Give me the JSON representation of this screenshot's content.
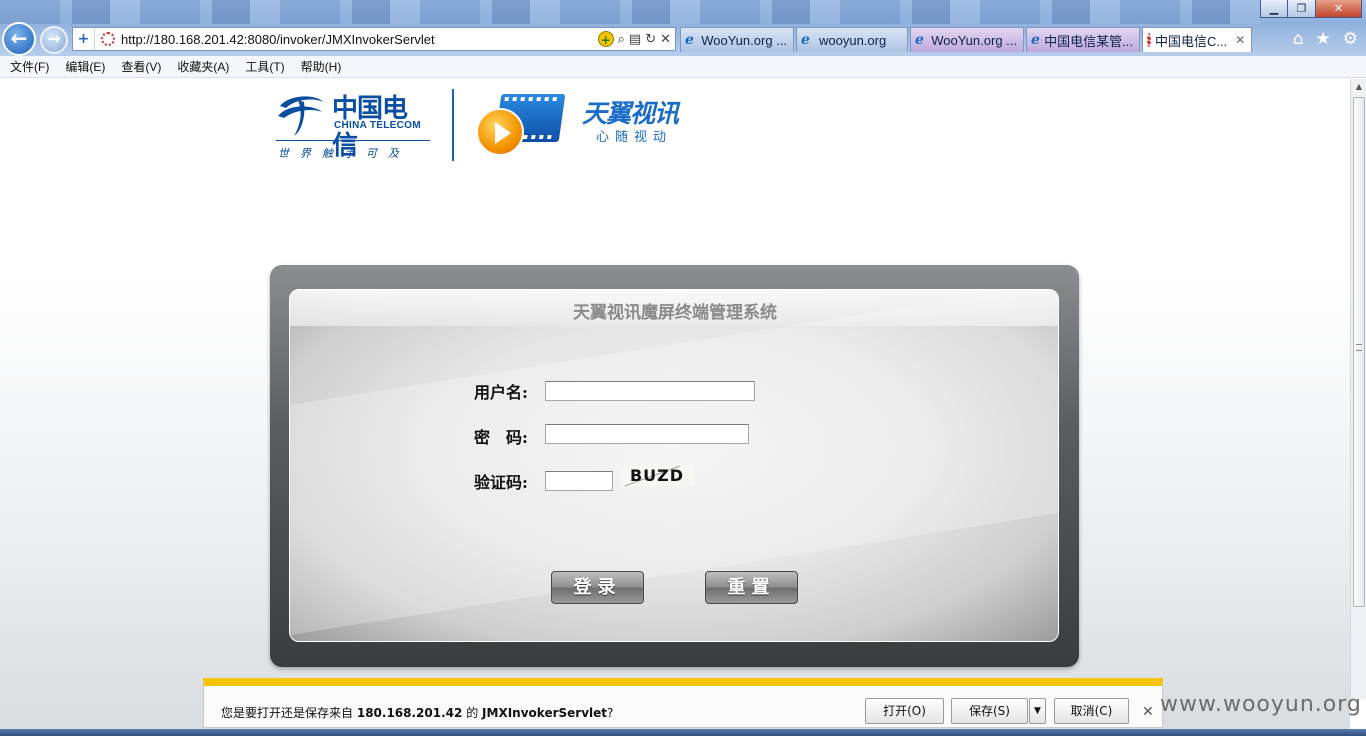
{
  "browser": {
    "window_buttons": [
      "▁",
      "❐",
      "✕"
    ],
    "address_url": "http://180.168.201.42:8080/invoker/JMXInvokerServlet",
    "tabs": [
      {
        "label": "WooYun.org ..."
      },
      {
        "label": "wooyun.org"
      },
      {
        "label": "WooYun.org ..."
      },
      {
        "label": "中国电信某管..."
      },
      {
        "label": "中国电信C..."
      }
    ],
    "menu": [
      "文件(F)",
      "编辑(E)",
      "查看(V)",
      "收藏夹(A)",
      "工具(T)",
      "帮助(H)"
    ]
  },
  "logos": {
    "telecom_cn": "中国电信",
    "telecom_en": "CHINA TELECOM",
    "telecom_slogan": "世界触手可及",
    "tianyi_cn": "天翼视讯",
    "tianyi_sub": "心随视动"
  },
  "login": {
    "title": "天翼视讯魔屏终端管理系统",
    "username_label": "用户名:",
    "password_label": "密　码:",
    "captcha_label": "验证码:",
    "captcha_text": "BUZD",
    "login_button": "登录",
    "reset_button": "重置"
  },
  "download_bar": {
    "prompt_prefix": "您是要打开还是保存来自",
    "host": "180.168.201.42",
    "prompt_middle": "的",
    "filename": "JMXInvokerServlet",
    "prompt_suffix": "?",
    "open_button": "打开(O)",
    "save_button": "保存(S)",
    "cancel_button": "取消(C)"
  },
  "watermark": "www.wooyun.org",
  "colors": {
    "telecom_blue": "#0a4ea2",
    "tianyi_blue": "#1a6cc8",
    "download_bar_accent": "#f6c400"
  }
}
